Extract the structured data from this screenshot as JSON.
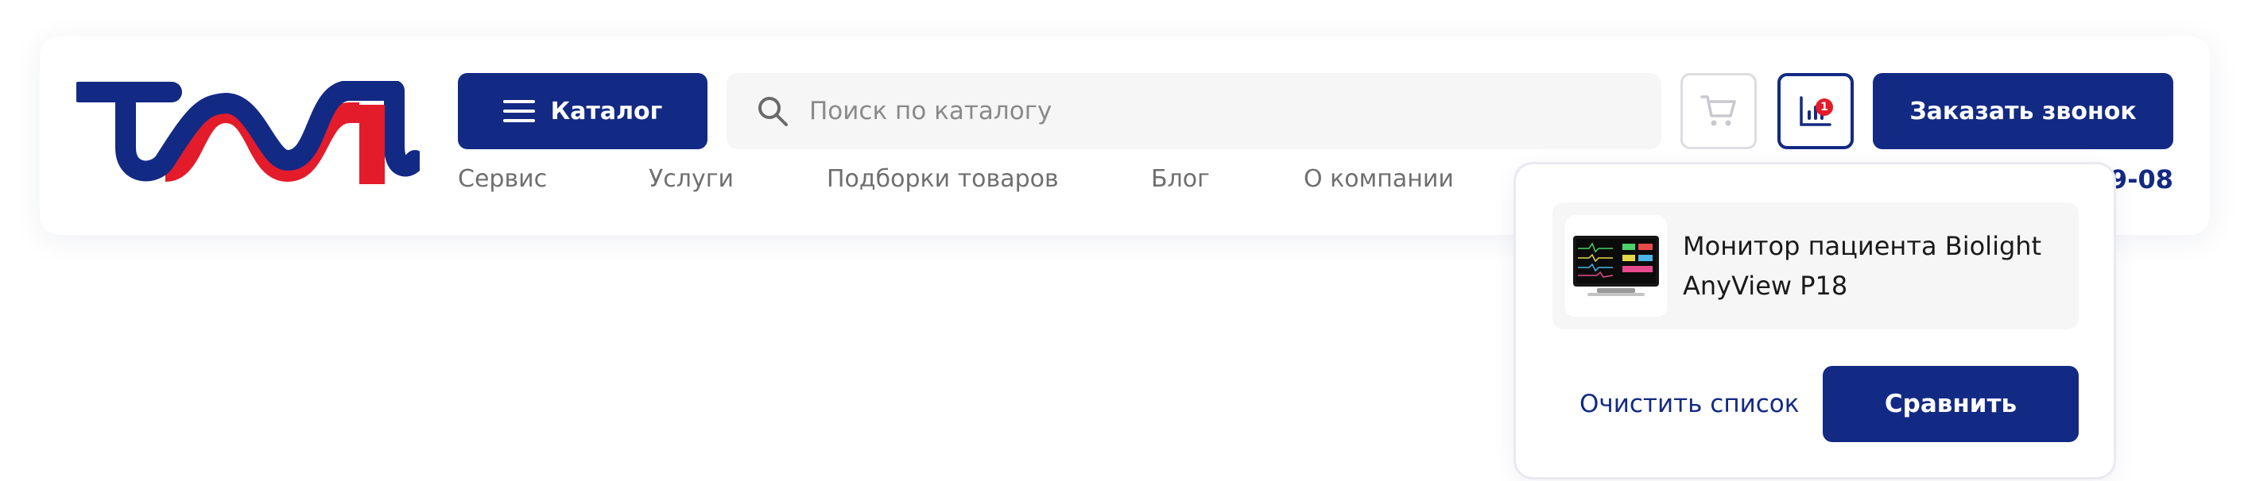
{
  "brand": {
    "logo_icon": "trim-logo",
    "colors": {
      "blue": "#132a84",
      "red": "#e41b2b"
    }
  },
  "header": {
    "catalog_label": "Каталог",
    "search": {
      "placeholder": "Поиск по каталогу",
      "value": ""
    },
    "compare_count": "1",
    "call_button": "Заказать звонок",
    "phone_visible_tail": "9-08"
  },
  "nav": [
    "Сервис",
    "Услуги",
    "Подборки товаров",
    "Блог",
    "О компании"
  ],
  "compare_dropdown": {
    "items": [
      {
        "title": "Монитор пациента Biolight AnyView P18"
      }
    ],
    "clear_label": "Очистить список",
    "compare_label": "Сравнить"
  },
  "colors": {
    "primary": "#132a84",
    "badge": "#e41b2b",
    "nav_text": "#6f6f6f",
    "search_bg": "#f6f6f7"
  }
}
